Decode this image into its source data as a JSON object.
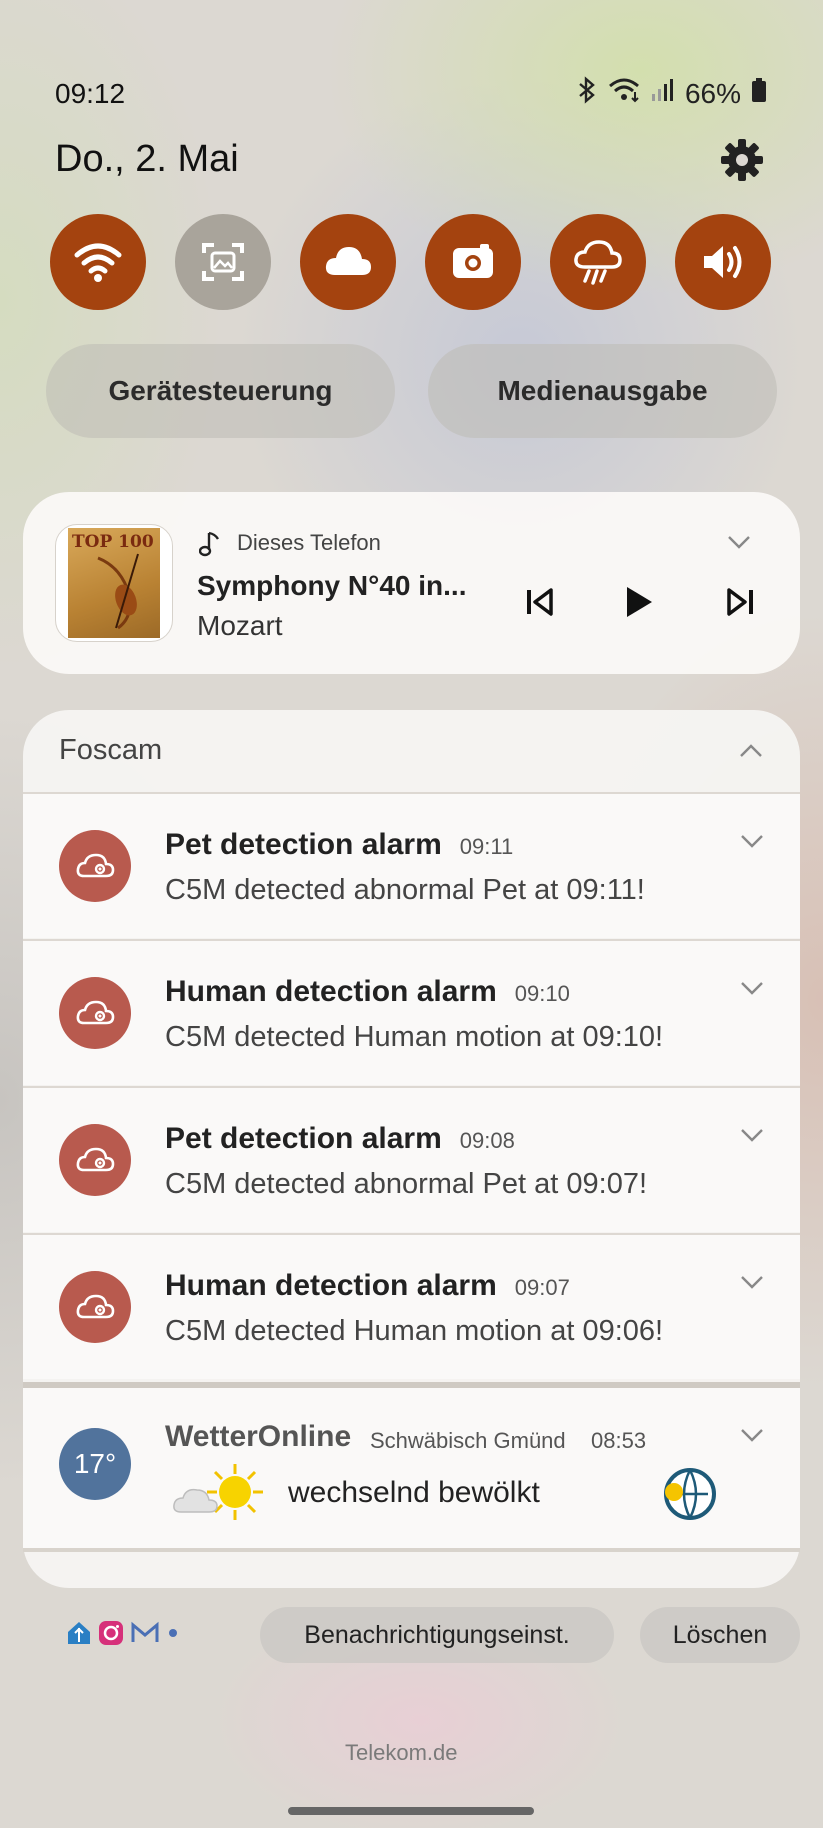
{
  "status": {
    "time": "09:12",
    "battery": "66%"
  },
  "date": "Do., 2. Mai",
  "quick_toggles": [
    {
      "icon": "wifi-icon",
      "active": true
    },
    {
      "icon": "screenshot-icon",
      "active": false
    },
    {
      "icon": "cloud-icon",
      "active": true
    },
    {
      "icon": "camera-icon",
      "active": true
    },
    {
      "icon": "rain-cloud-icon",
      "active": true
    },
    {
      "icon": "sound-icon",
      "active": true
    }
  ],
  "pills": {
    "device_control": "Gerätesteuerung",
    "media_output": "Medienausgabe"
  },
  "media": {
    "album_art_text": "TOP 100",
    "source": "Dieses Telefon",
    "title": "Symphony N°40 in...",
    "artist": "Mozart"
  },
  "group": {
    "app": "Foscam",
    "notifications": [
      {
        "title": "Pet detection alarm",
        "time": "09:11",
        "body": "C5M detected abnormal Pet at 09:11!"
      },
      {
        "title": "Human detection alarm",
        "time": "09:10",
        "body": "C5M detected Human motion at 09:10!"
      },
      {
        "title": "Pet detection alarm",
        "time": "09:08",
        "body": "C5M detected abnormal Pet at 09:07!"
      },
      {
        "title": "Human detection alarm",
        "time": "09:07",
        "body": "C5M detected Human motion at 09:06!"
      }
    ]
  },
  "weather": {
    "app": "WetterOnline",
    "location": "Schwäbisch Gmünd",
    "time": "08:53",
    "temp": "17°",
    "condition": "wechselnd bewölkt"
  },
  "footer": {
    "settings_button": "Benachrichtigungseinst.",
    "clear_button": "Löschen",
    "carrier": "Telekom.de"
  },
  "colors": {
    "toggle_active": "#a4430f",
    "toggle_inactive": "#a9a49b",
    "foscam_avatar": "#b85a4e",
    "weather_avatar": "#51739c"
  }
}
